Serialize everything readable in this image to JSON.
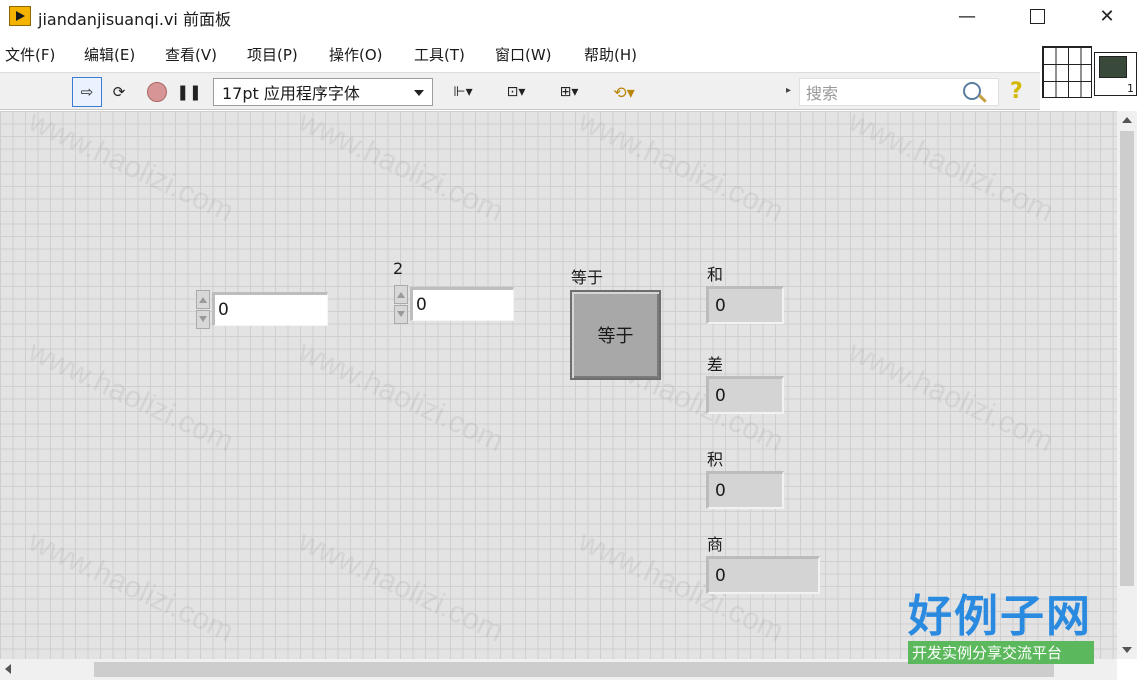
{
  "window": {
    "title": "jiandanjisuanqi.vi 前面板",
    "minimize": "—",
    "close": "✕"
  },
  "menu": [
    "文件(F)",
    "编辑(E)",
    "查看(V)",
    "项目(P)",
    "操作(O)",
    "工具(T)",
    "窗口(W)",
    "帮助(H)"
  ],
  "toolbar": {
    "font": "17pt 应用程序字体",
    "search_placeholder": "搜索",
    "help": "?"
  },
  "controls": {
    "input1": {
      "label": "",
      "value": "0"
    },
    "input2": {
      "label": "2",
      "value": "0"
    },
    "equals_button": {
      "label": "等于",
      "text": "等于"
    }
  },
  "indicators": {
    "sum": {
      "label": "和",
      "value": "0"
    },
    "diff": {
      "label": "差",
      "value": "0"
    },
    "product": {
      "label": "积",
      "value": "0"
    },
    "quotient": {
      "label": "商",
      "value": "0"
    }
  },
  "watermark": {
    "text": "www.haolizi.com",
    "brand": "好例子网",
    "brand_sub": "开发实例分享交流平台"
  }
}
